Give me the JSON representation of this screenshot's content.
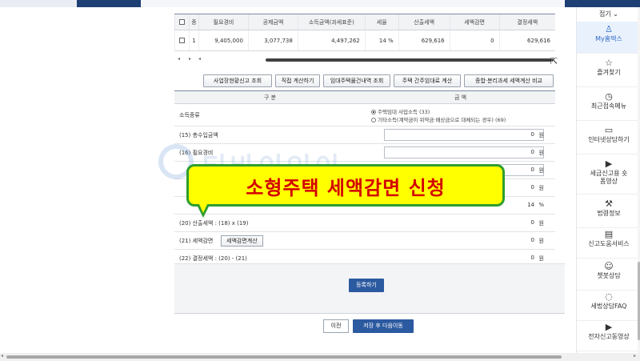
{
  "table": {
    "headers": [
      "종",
      "필요경비",
      "공제금액",
      "소득금액(과세표준)",
      "세율",
      "산출세액",
      "세액감면",
      "결정세액"
    ],
    "row": [
      "1",
      "9,405,000",
      "3,077,738",
      "4,497,262",
      "14 %",
      "629,616",
      "0",
      "629,616"
    ]
  },
  "buttons": {
    "b1": "사업장현황신고 조회",
    "b2": "직접 계산하기",
    "b3": "임대주택물건내역 조회",
    "b4": "주택 간주임대료 계산",
    "b5": "종합·분리과세 세액계산 비교"
  },
  "form": {
    "col1": "구 분",
    "col2": "금 액",
    "income_type": "소득종류",
    "radio1": "주택임대 사업소득 (33)",
    "radio2": "기타소득(계약금이 위약금·배상금으로 대체되는 경우) (69)",
    "r15_label": "(15) 총수입금액",
    "r15_val": "0",
    "r16_label": "(16) 필요경비",
    "r16_val": "0",
    "r17_val": "0",
    "r18_val": "0",
    "r19_val": "14",
    "r19_unit": "%",
    "r20_label": "(20) 산출세액 : (18) x (19)",
    "r20_val": "0",
    "r21_label": "(21) 세액감면",
    "r21_button": "세액감면계산",
    "r21_val": "0",
    "r22_label": "(22) 결정세액 : (20) - (21)",
    "r22_val": "0",
    "won": "원"
  },
  "actions": {
    "register": "등록하기",
    "prev": "이전",
    "save_next": "저장 후 다음이동"
  },
  "watermark": "티바이인이",
  "callout": "소형주택 세액감면 신청",
  "sidebar": {
    "top": "접기",
    "items": [
      {
        "label": "My홈택스",
        "icon": "user-icon"
      },
      {
        "label": "즐겨찾기",
        "icon": "star-icon"
      },
      {
        "label": "최근접속메뉴",
        "icon": "clock-icon"
      },
      {
        "label": "인터넷상담하기",
        "icon": "monitor-icon"
      },
      {
        "label": "세금신고용 숏폼영상",
        "icon": "play-icon"
      },
      {
        "label": "법령정보",
        "icon": "gavel-icon"
      },
      {
        "label": "신고도움서비스",
        "icon": "book-icon"
      },
      {
        "label": "챗봇상담",
        "icon": "chatbot-icon"
      },
      {
        "label": "세법상담FAQ",
        "icon": "chat-icon"
      },
      {
        "label": "전자신고동영상",
        "icon": "video-icon"
      }
    ]
  }
}
